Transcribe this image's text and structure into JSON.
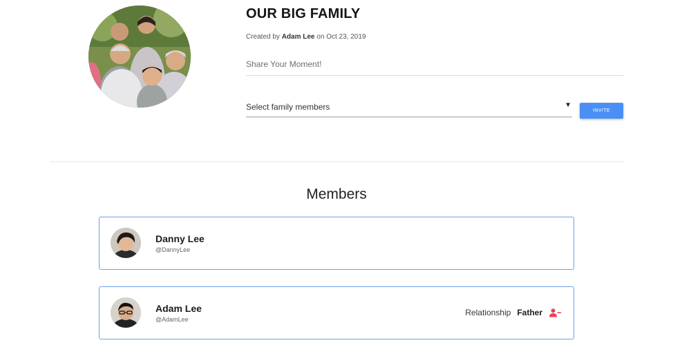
{
  "group": {
    "title": "OUR BIG FAMILY",
    "created_prefix": "Created by",
    "created_by": "Adam Lee",
    "created_on_prefix": "on",
    "created_date": "Oct 23, 2019",
    "photo_icon": "family-photo"
  },
  "share": {
    "placeholder": "Share Your Moment!"
  },
  "invite": {
    "select_label": "Select family members",
    "arrow": "▼",
    "button_label": "INVITE",
    "button_color": "#4a8ff5"
  },
  "members_section": {
    "heading": "Members",
    "card_border_color": "#6d9eea",
    "members": [
      {
        "name": "Danny Lee",
        "handle": "@DannyLee"
      },
      {
        "name": "Adam Lee",
        "handle": "@AdamLee",
        "relationship_label": "Relationship",
        "relationship": "Father",
        "remove_icon": "remove-user-icon",
        "remove_icon_color": "#e8415a"
      }
    ]
  }
}
